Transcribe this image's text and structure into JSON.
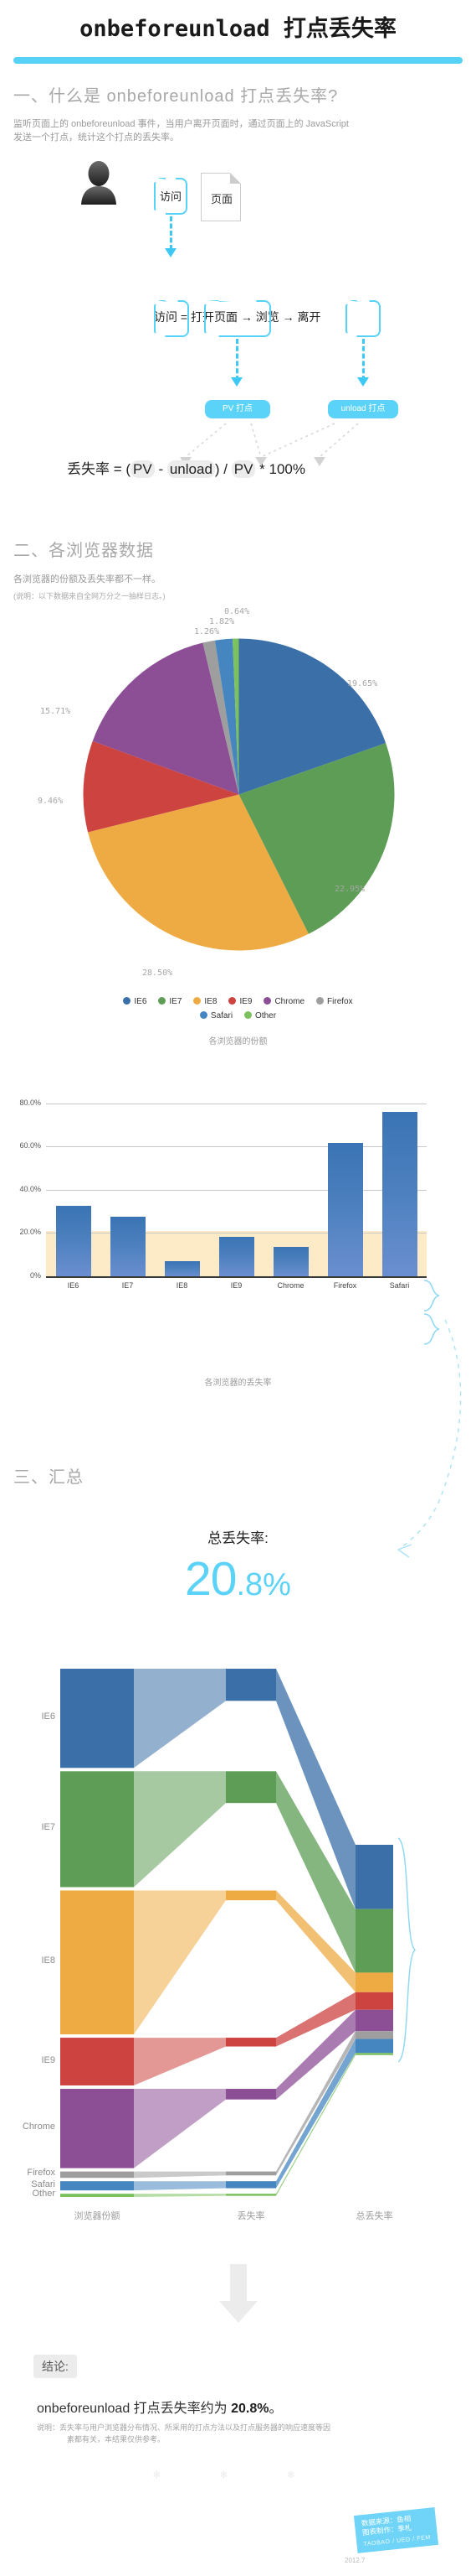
{
  "header": {
    "title": "onbeforeunload 打点丢失率"
  },
  "section1": {
    "heading": "一、什么是 onbeforeunload 打点丢失率?",
    "paragraph_line1": "监听页面上的 onbeforeunload 事件，当用户离开页面时，通过页面上的 JavaScript",
    "paragraph_line2": "发送一个打点，统计这个打点的丢失率。",
    "diagram": {
      "user_icon": "person-icon",
      "visit_label": "访问",
      "page_label": "页面",
      "flow_text_visit": "访问",
      "flow_text_equals": "=",
      "flow_text_open": "打开页面",
      "flow_arrow1": "→",
      "flow_text_browse": "浏览",
      "flow_arrow2": "→",
      "flow_text_leave": "离开",
      "pill_pv": "PV 打点",
      "pill_unload": "unload 打点",
      "formula_prefix": "丢失率 = (",
      "formula_pv1": "PV",
      "formula_minus": " - ",
      "formula_unload": "unload",
      "formula_mid": ") / ",
      "formula_pv2": "PV",
      "formula_suffix": " * 100%"
    }
  },
  "section2": {
    "heading": "二、各浏览器数据",
    "paragraph": "各浏览器的份额及丢失率都不一样。",
    "note": "(说明：以下数据来自全网万分之一抽样日志。)",
    "pie_caption": "各浏览器的份额",
    "bar_caption": "各浏览器的丢失率"
  },
  "section3": {
    "heading": "三、汇总",
    "total_label": "总丢失率:",
    "total_value_big": "20",
    "total_value_small": ".8%",
    "sankey_col_labels": [
      "浏览器份额",
      "丢失率",
      "总丢失率"
    ]
  },
  "conclusion": {
    "tag": "结论:",
    "main_prefix": "onbeforeunload 打点丢失率约为 ",
    "main_value": "20.8%",
    "main_suffix": "。",
    "note_line1": "说明：丢失率与用户浏览器分布情况、所采用的打点方法以及打点服务器的响应速度等因",
    "note_line2": "素都有关，本结果仅供参考。",
    "dots": "✻ ✻ ✻"
  },
  "credit": {
    "line1": "数据来源：鱼相",
    "line2": "图表制作：季札",
    "sub": "TAOBAO / UED / FEM",
    "date": "2012.7"
  },
  "colors": {
    "accent": "#57d2f7",
    "ie6": "#3a6fa8",
    "ie7": "#5e9d56",
    "ie8": "#eeab44",
    "ie9": "#cc4340",
    "chrome": "#8c4f96",
    "firefox": "#9e9e9e",
    "safari": "#4686c0",
    "other": "#7bc15e",
    "band": "#fdebc8",
    "bar": "#4b7fbe"
  },
  "chart_data": [
    {
      "type": "pie",
      "title": "各浏览器的份额",
      "labels": [
        "IE6",
        "IE7",
        "IE8",
        "IE9",
        "Chrome",
        "Firefox",
        "Safari",
        "Other"
      ],
      "values": [
        19.65,
        22.95,
        28.5,
        9.46,
        15.71,
        1.26,
        1.82,
        0.64
      ],
      "value_labels": [
        "19.65%",
        "22.95%",
        "28.50%",
        "9.46%",
        "15.71%",
        "1.26%",
        "1.82%",
        "0.64%"
      ],
      "colors": [
        "#3a6fa8",
        "#5e9d56",
        "#eeab44",
        "#cc4340",
        "#8c4f96",
        "#9e9e9e",
        "#4686c0",
        "#7bc15e"
      ],
      "units": "percent",
      "legend_position": "bottom"
    },
    {
      "type": "bar",
      "title": "各浏览器的丢失率",
      "categories": [
        "IE6",
        "IE7",
        "IE8",
        "IE9",
        "Chrome",
        "Firefox",
        "Safari"
      ],
      "values": [
        32.4,
        27.4,
        6.8,
        18.4,
        13.4,
        61.6,
        76.2
      ],
      "ylabel": "",
      "xlabel": "",
      "ylim": [
        0,
        90
      ],
      "yticks": [
        0,
        20,
        40,
        60,
        80
      ],
      "ytick_labels": [
        "0%",
        "20.0%",
        "40.0%",
        "60.0%",
        "80.0%"
      ],
      "grid": true,
      "highlight_band": [
        0,
        20.8
      ],
      "bar_color": "#4b7fbe"
    },
    {
      "type": "sankey",
      "title": "汇总",
      "stage_labels": [
        "浏览器份额",
        "丢失率",
        "总丢失率"
      ],
      "nodes": [
        "IE6",
        "IE7",
        "IE8",
        "IE9",
        "Chrome",
        "Firefox",
        "Safari",
        "Other"
      ],
      "share": [
        19.65,
        22.95,
        28.5,
        9.46,
        15.71,
        1.26,
        1.82,
        0.64
      ],
      "loss_rate": [
        32.4,
        27.4,
        6.8,
        18.4,
        13.4,
        61.6,
        76.2,
        20.8
      ],
      "contribution": [
        6.37,
        6.29,
        1.94,
        1.74,
        2.11,
        0.78,
        1.39,
        0.13
      ],
      "total": 20.8,
      "colors": [
        "#3a6fa8",
        "#5e9d56",
        "#eeab44",
        "#cc4340",
        "#8c4f96",
        "#9e9e9e",
        "#4686c0",
        "#7bc15e"
      ]
    }
  ]
}
